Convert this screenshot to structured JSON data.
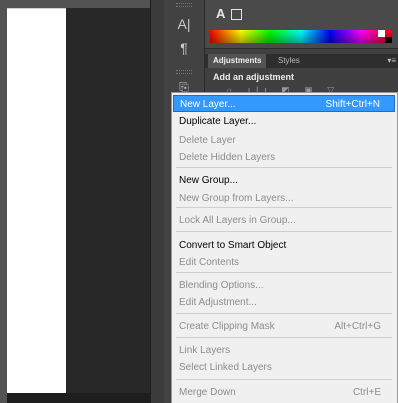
{
  "tools": {
    "character_label": "A|",
    "paragraph_label": "¶",
    "layer_comp_label": "⎘"
  },
  "color_panel": {
    "text_glyph": "A"
  },
  "panel_tabs": {
    "adjustments": "Adjustments",
    "styles": "Styles",
    "menu_glyph": "▾≡"
  },
  "adjustments": {
    "title": "Add an adjustment",
    "icons_text": "☼ ılı ◩ ▣ ▽"
  },
  "context_menu": {
    "items": [
      {
        "label": "New Layer...",
        "shortcut": "Shift+Ctrl+N",
        "state": "selected"
      },
      {
        "label": "Duplicate Layer...",
        "shortcut": "",
        "state": "enabled"
      },
      {
        "label": "Delete Layer",
        "shortcut": "",
        "state": "disabled"
      },
      {
        "label": "Delete Hidden Layers",
        "shortcut": "",
        "state": "disabled"
      },
      {
        "label": "New Group...",
        "shortcut": "",
        "state": "enabled"
      },
      {
        "label": "New Group from Layers...",
        "shortcut": "",
        "state": "disabled"
      },
      {
        "label": "Lock All Layers in Group...",
        "shortcut": "",
        "state": "disabled"
      },
      {
        "label": "Convert to Smart Object",
        "shortcut": "",
        "state": "enabled"
      },
      {
        "label": "Edit Contents",
        "shortcut": "",
        "state": "disabled"
      },
      {
        "label": "Blending Options...",
        "shortcut": "",
        "state": "disabled"
      },
      {
        "label": "Edit Adjustment...",
        "shortcut": "",
        "state": "disabled"
      },
      {
        "label": "Create Clipping Mask",
        "shortcut": "Alt+Ctrl+G",
        "state": "disabled"
      },
      {
        "label": "Link Layers",
        "shortcut": "",
        "state": "disabled"
      },
      {
        "label": "Select Linked Layers",
        "shortcut": "",
        "state": "disabled"
      },
      {
        "label": "Merge Down",
        "shortcut": "Ctrl+E",
        "state": "disabled"
      }
    ]
  }
}
